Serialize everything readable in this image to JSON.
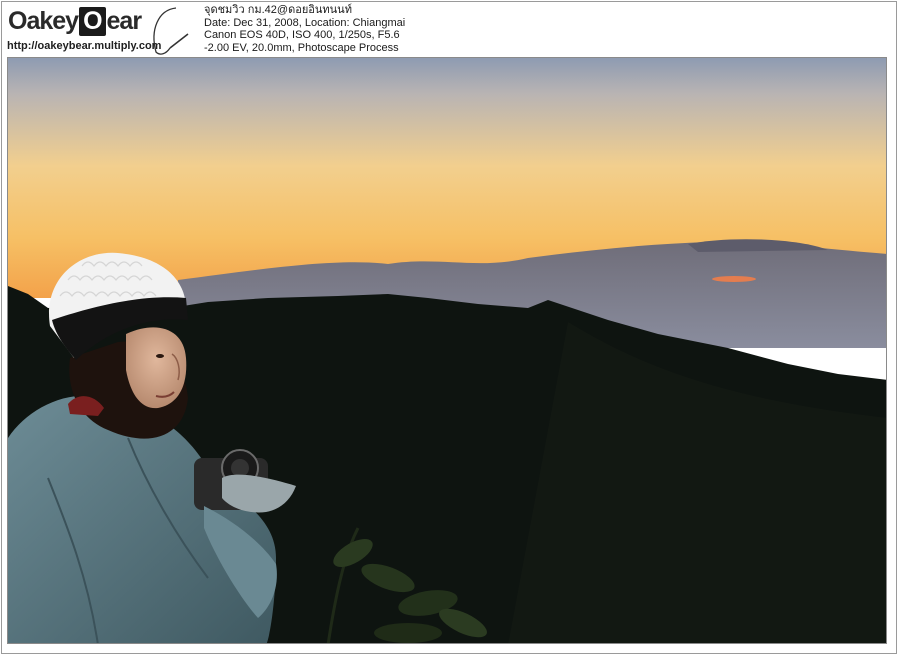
{
  "watermark": {
    "logo_left": "Oakey",
    "logo_mid": "O",
    "logo_right": "ear",
    "url": "http://oakeybear.multiply.com"
  },
  "photo_info": {
    "title": "จุดชมวิว กม.42@ดอยอินทนนท์",
    "date_location": "Date: Dec 31, 2008, Location: Chiangmai",
    "camera": "Canon EOS 40D, ISO 400, 1/250s, F5.6",
    "exposure": "-2.00 EV, 20.0mm, Photoscape Process"
  },
  "colors": {
    "sky_top": "#8e9bb2",
    "sky_mid": "#f2cf8e",
    "sky_horizon": "#f3a24a",
    "mountain": "#0e1410",
    "jacket": "#5a7782",
    "hat": "#f2f2f2"
  }
}
